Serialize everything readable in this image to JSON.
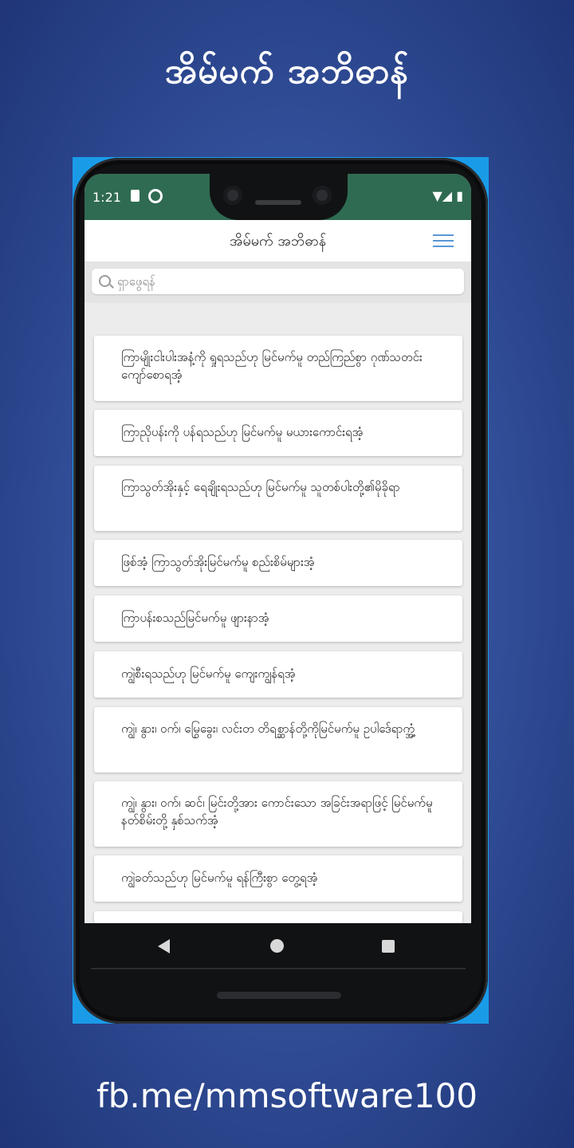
{
  "promo": {
    "title": "အိမ်မက် အဘိဓာန်",
    "footer": "fb.me/mmsoftware100"
  },
  "statusbar": {
    "time": "1:21",
    "right": "▼◢ ▮"
  },
  "app": {
    "title": "အိမ်မက် အဘိဓာန်",
    "menu_icon": "list-menu-icon"
  },
  "search": {
    "placeholder": "ရှာဖွေရန်"
  },
  "entries": [
    "ကြာမျိုးငါးပါးအနံ့ကို ရှုရသည်ဟု မြင်မက်မူ တည်ကြည်စွာ ဂုဏ်သတင်းကျော်စောရအံ့",
    "ကြာညိုပန်းကို ပန်ရသည်ဟု မြင်မက်မူ မယားကောင်းရအံ့",
    "ကြာသွတ်အိုးနှင့် ရေချိုးရသည်ဟု မြင်မက်မူ သူတစ်ပါးတို့၏မိုခိုရာ",
    "ဖြစ်အံ့ ကြာသွတ်အိုးမြင်မက်မူ စည်းစိမ်များအံ့",
    "ကြာပန်းစသည်မြင်မက်မူ ဖျားနာအံ့",
    "ကျွဲစီးရသည်ဟု မြင်မက်မူ ကျေးကျွန်ရအံ့",
    "ကျွဲ၊ နွား၊ ဝက်၊ မြွေခွေး၊ လင်းတ တိရစ္ဆာန်တို့ကိုမြင်မက်မူ ဥပါဒ်ေရာက္အံ့",
    "ကျွဲ၊ နွား၊ ဝက်၊ ဆင်၊ မြင်းတို့အား ကောင်းသော အခြင်းအရာဖြင့် မြင်မက်မူ နတ်စိမ်းတို့ နှစ်သက်အံ့",
    "ကျွဲခတ်သည်ဟု မြင်မက်မူ ရန်ကြီးစွာ တွေ့ရအံ့",
    ""
  ],
  "nav": {
    "back_icon": "triangle-back-icon",
    "home_icon": "circle-home-icon",
    "recent_icon": "square-recent-icon"
  }
}
